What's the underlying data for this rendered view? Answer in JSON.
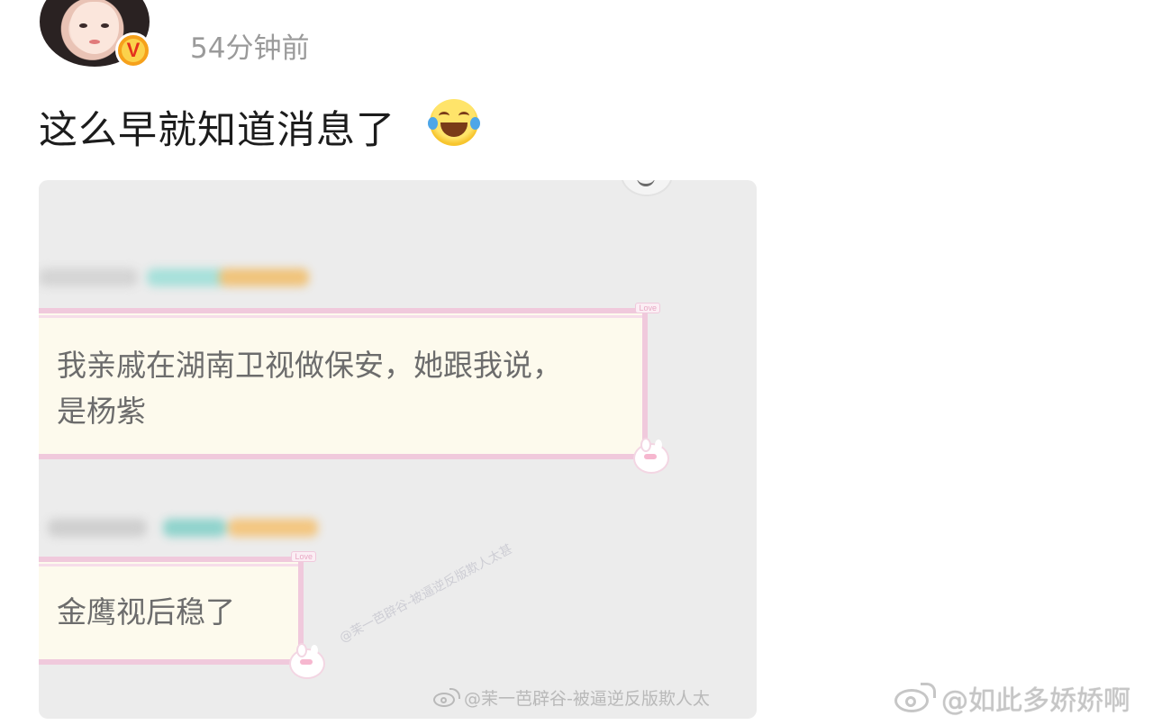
{
  "post": {
    "time": "54分钟前",
    "text": "这么早就知道消息了",
    "emoji": "laughing-with-tears"
  },
  "image": {
    "bubble1": {
      "line1": "我亲戚在湖南卫视做保安，她跟我说，",
      "line2": "是杨紫",
      "tag": "Love"
    },
    "bubble2": {
      "line1": "金鹰视后稳了",
      "tag": "Love"
    },
    "inner_watermark": "@茉一芭辟谷-被逼逆反版欺人太",
    "diagonal_watermark": "@茉一芭辟谷-被逼逆反版欺人太甚"
  },
  "outer_watermark": "@如此多娇娇啊",
  "colors": {
    "bubble_border": "#f0c9dc",
    "bubble_fill": "#fdfaed",
    "badge_orange": "#f6a11b",
    "time_gray": "#9a9a9a"
  }
}
